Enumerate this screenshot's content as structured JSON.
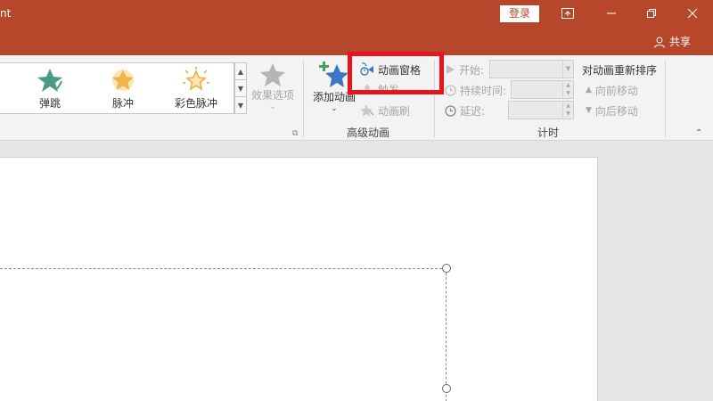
{
  "titlebar": {
    "app_title": "nt",
    "login_label": "登录",
    "share_label": "共享"
  },
  "gallery": {
    "items": [
      {
        "label": "弹跳",
        "icon": "bounce-star-icon"
      },
      {
        "label": "脉冲",
        "icon": "pulse-star-icon"
      },
      {
        "label": "彩色脉冲",
        "icon": "color-pulse-star-icon"
      }
    ]
  },
  "effects": {
    "effect_options_label": "效果选项"
  },
  "advanced": {
    "add_animation_label": "添加动画",
    "animation_pane_label": "动画窗格",
    "trigger_label": "触发",
    "painter_label": "动画刷",
    "group_label": "高级动画"
  },
  "timing": {
    "start_label": "开始:",
    "duration_label": "持续时间:",
    "delay_label": "延迟:",
    "reorder_title": "对动画重新排序",
    "move_earlier_label": "向前移动",
    "move_later_label": "向后移动",
    "group_label": "计时"
  },
  "colors": {
    "accent": "#b7472a",
    "highlight": "#e8141c"
  }
}
